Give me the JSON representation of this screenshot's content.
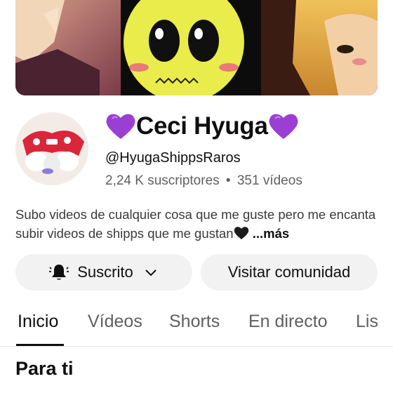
{
  "channel": {
    "name": "Ceci Hyuga",
    "handle": "@HyugaShippsRaros",
    "subscribers": "2,24 K suscriptores",
    "separator": "•",
    "videos": "351 vídeos",
    "description": "Subo videos de cualquier cosa que me guste pero me encanta subir videos de shipps que me gustan",
    "more_label": "...más"
  },
  "actions": {
    "subscribed_label": "Suscrito",
    "community_label": "Visitar comunidad"
  },
  "tabs": [
    {
      "label": "Inicio",
      "active": true
    },
    {
      "label": "Vídeos",
      "active": false
    },
    {
      "label": "Shorts",
      "active": false
    },
    {
      "label": "En directo",
      "active": false
    },
    {
      "label": "Lis",
      "active": false
    }
  ],
  "section": {
    "title": "Para ti"
  },
  "colors": {
    "heart": "#9b3fd4",
    "button_bg": "#f2f2f2",
    "secondary_text": "#606060"
  },
  "icons": [
    "purple-heart-icon",
    "black-heart-icon",
    "bell-icon",
    "chevron-down-icon"
  ]
}
